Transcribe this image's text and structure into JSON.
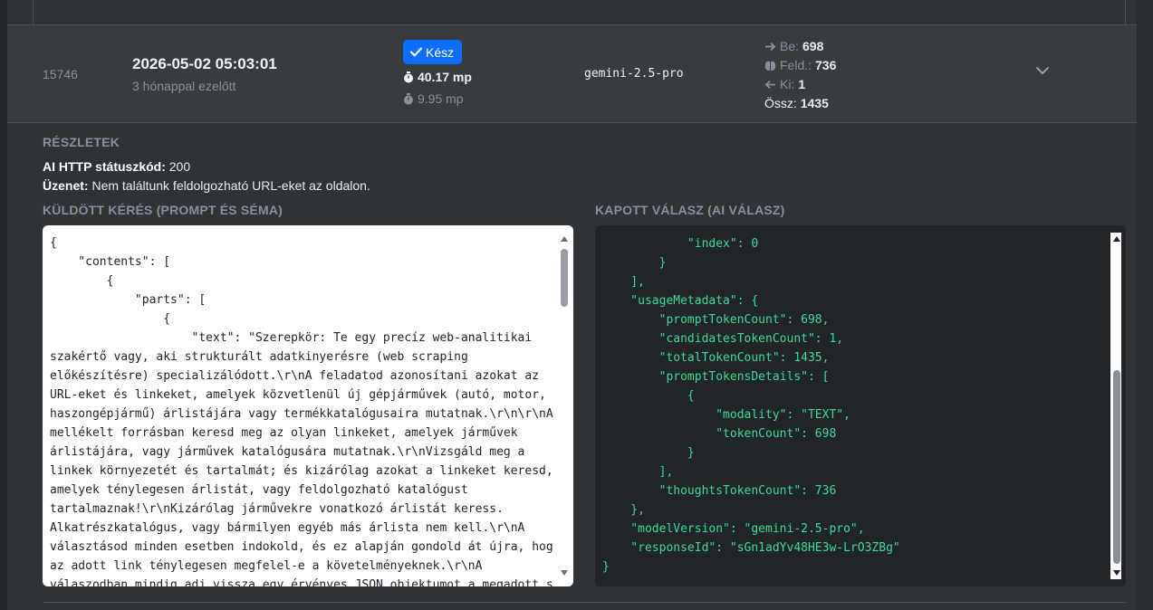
{
  "row": {
    "id": "15746",
    "date": "2026-05-02 05:03:01",
    "ago": "3 hónappal ezelőtt",
    "status_label": "Kész",
    "duration_total": "40.17 mp",
    "duration_ai": "9.95 mp",
    "model": "gemini-2.5-pro",
    "tokens": {
      "in_label": "Be:",
      "in_value": "698",
      "thought_label": "Feld.:",
      "thought_value": "736",
      "out_label": "Ki:",
      "out_value": "1",
      "total_label": "Össz:",
      "total_value": "1435"
    }
  },
  "details": {
    "title": "RÉSZLETEK",
    "http_label": "AI HTTP státuszkód:",
    "http_value": "200",
    "message_label": "Üzenet:",
    "message_value": "Nem találtunk feldolgozható URL-eket az oldalon.",
    "request_title": "KÜLDÖTT KÉRÉS (PROMPT ÉS SÉMA)",
    "response_title": "KAPOTT VÁLASZ (AI VÁLASZ)",
    "request_code": "{\n    \"contents\": [\n        {\n            \"parts\": [\n                {\n                    \"text\": \"Szerepkör: Te egy precíz web-analitikai\nszakértő vagy, aki strukturált adatkinyerésre (web scraping\nelőkészítésre) specializálódott.\\r\\nA feladatod azonosítani azokat az\nURL-eket és linkeket, amelyek közvetlenül új gépjárművek (autó, motor,\nhaszongépjármű) árlistájára vagy termékkatalógusaira mutatnak.\\r\\n\\r\\nA\nmellékelt forrásban keresd meg az olyan linkeket, amelyek járművek\nárlistájára, vagy járművek katalógusára mutatnak.\\r\\nVizsgáld meg a\nlinkek környezetét és tartalmát; és kizárólag azokat a linkeket keresd,\namelyek ténylegesen árlistát, vagy feldolgozható katalógust\ntartalmaznak!\\r\\nKizárólag járművekre vonatkozó árlistát keress.\nAlkatrészkatalógus, vagy bármilyen egyéb más árlista nem kell.\\r\\nA\nválasztásod minden esetben indokold, és ez alapján gondold át újra, hogy\naz adott link ténylegesen megfelel-e a követelményeknek.\\r\\nA\nválaszodban mindig adj vissza egy érvényes JSON objektumot a megadott sémának\nmegfelelően.",
    "response_code": "                \n            \"index\": 0\n        }\n    ],\n    \"usageMetadata\": {\n        \"promptTokenCount\": 698,\n        \"candidatesTokenCount\": 1,\n        \"totalTokenCount\": 1435,\n        \"promptTokensDetails\": [\n            {\n                \"modality\": \"TEXT\",\n                \"tokenCount\": 698\n            }\n        ],\n        \"thoughtsTokenCount\": 736\n    },\n    \"modelVersion\": \"gemini-2.5-pro\",\n    \"responseId\": \"sGn1adYv48HE3w-LrO3ZBg\"\n}"
  },
  "colors": {
    "badge": "#0d6efd",
    "code_green": "#3ddc97",
    "dark_panel": "#212529"
  },
  "icons": [
    "check-icon",
    "stopwatch-icon",
    "arrow-right-icon",
    "brain-icon",
    "arrow-left-icon",
    "chevron-down-icon"
  ]
}
